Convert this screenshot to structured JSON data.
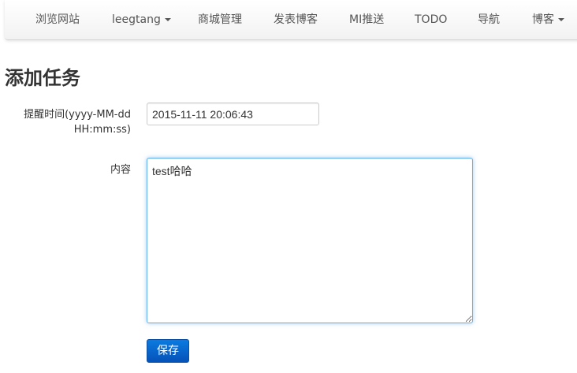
{
  "navbar": {
    "items": [
      {
        "label": "浏览网站",
        "dropdown": false
      },
      {
        "label": "leegtang",
        "dropdown": true
      },
      {
        "label": "商城管理",
        "dropdown": false
      },
      {
        "label": "发表博客",
        "dropdown": false
      },
      {
        "label": "MI推送",
        "dropdown": false
      },
      {
        "label": "TODO",
        "dropdown": false
      },
      {
        "label": "导航",
        "dropdown": false
      },
      {
        "label": "博客",
        "dropdown": true
      }
    ]
  },
  "page": {
    "title": "添加任务"
  },
  "form": {
    "time_label_line1": "提醒时间(yyyy-MM-dd",
    "time_label_line2": "HH:mm:ss)",
    "time_value": "2015-11-11 20:06:43",
    "content_label": "内容",
    "content_value": "test哈哈",
    "save_label": "保存"
  },
  "colors": {
    "primary_button": "#0b6fd6",
    "focus_border": "#66afe9",
    "nav_text": "#555555"
  }
}
